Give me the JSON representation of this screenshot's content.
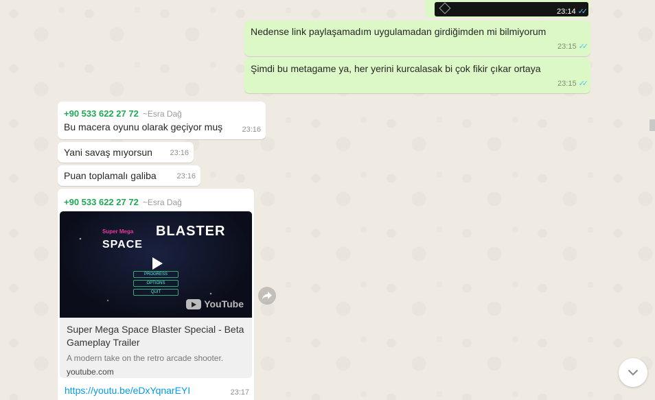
{
  "messages": [
    {
      "type": "outgoing-media",
      "time": "23:14",
      "ticks": "✓✓"
    },
    {
      "type": "outgoing",
      "text": "Nedense link paylaşamadım uygulamadan girdiğimden mi bilmiyorum",
      "time": "23:15",
      "ticks": "✓✓"
    },
    {
      "type": "outgoing",
      "text": "Şimdi bu metagame ya, her yerini kurcalasak bi çok fikir çıkar ortaya",
      "time": "23:15",
      "ticks": "✓✓"
    },
    {
      "type": "incoming",
      "sender": "+90 533 622 27 72",
      "alias": "~Esra Dağ",
      "text": "Bu macera oyunu olarak geçiyor muş",
      "time": "23:16"
    },
    {
      "type": "incoming",
      "text": "Yani savaş mıyorsun",
      "time": "23:16"
    },
    {
      "type": "incoming",
      "text": "Puan toplamalı galiba",
      "time": "23:16"
    },
    {
      "type": "incoming-link",
      "sender": "+90 533 622 27 72",
      "alias": "~Esra Dağ",
      "preview": {
        "game_title_small": "Super Mega",
        "game_title_big1": "SPACE",
        "game_title_big2": "BLASTER",
        "menu": [
          "PROGRESS",
          "OPTIONS",
          "QUIT"
        ],
        "youtube_label": "YouTube",
        "title": "Super Mega Space Blaster Special - Beta Gameplay Trailer",
        "description": "A modern take on the retro arcade shooter.",
        "domain": "youtube.com"
      },
      "link": "https://youtu.be/eDxYqnarEYI",
      "time": "23:17"
    }
  ],
  "colors": {
    "outgoing": "#dcf8c6",
    "incoming": "#ffffff",
    "sender": "#1fa855",
    "link": "#039be5",
    "ticks": "#4fc3f7"
  },
  "icons": {
    "forward": "forward-icon",
    "scroll_down": "chevron-down-icon",
    "play": "play-icon"
  }
}
